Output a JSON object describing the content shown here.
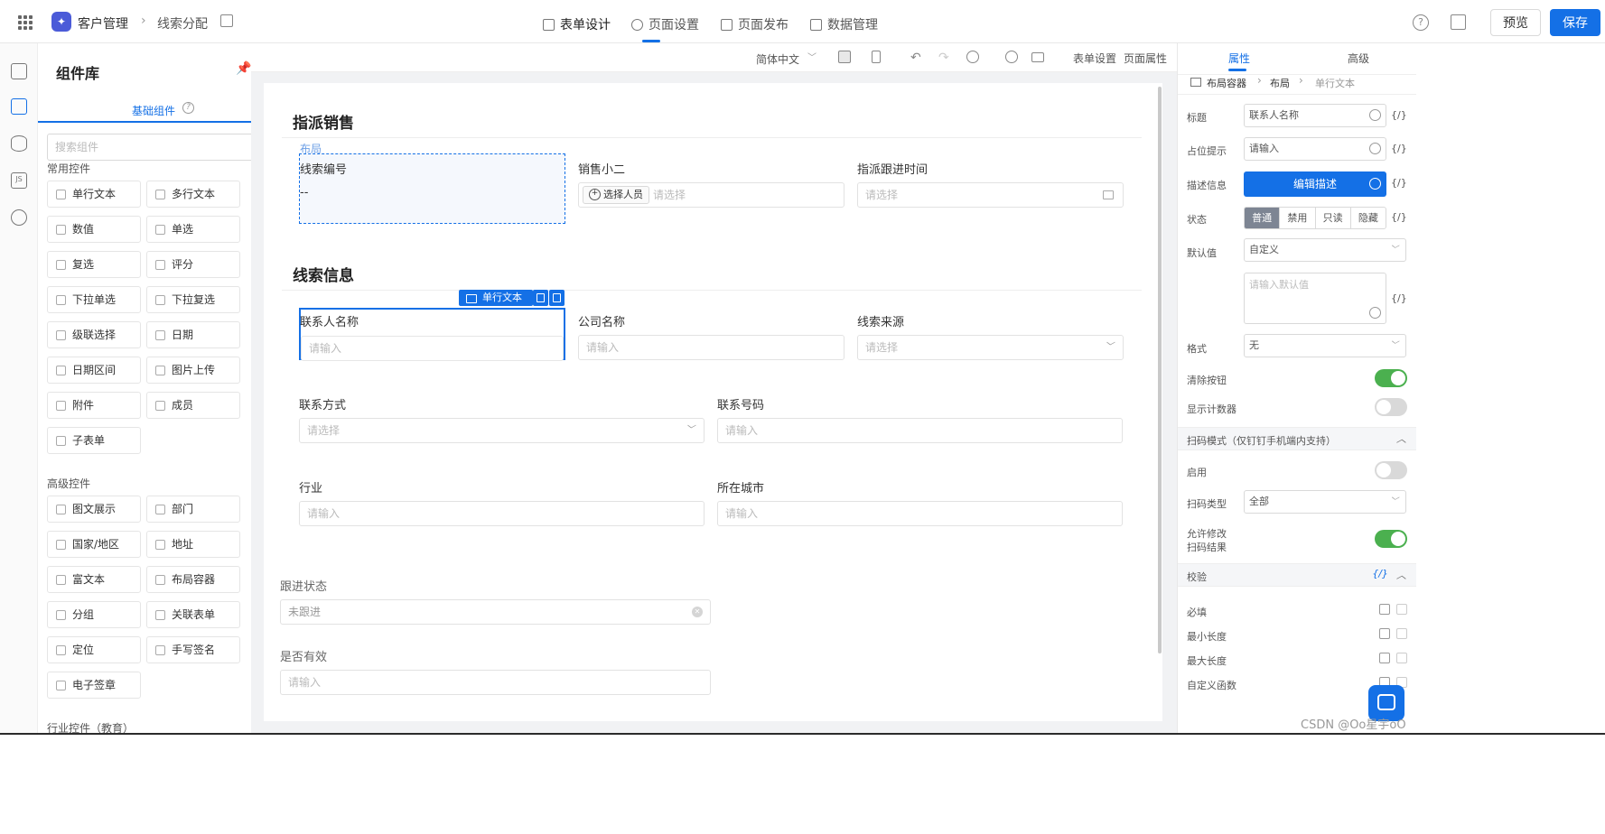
{
  "topbar": {
    "app_name": "客户管理",
    "page_name": "线索分配",
    "tabs": [
      "表单设计",
      "页面设置",
      "页面发布",
      "数据管理"
    ],
    "preview": "预览",
    "save": "保存",
    "help": "?"
  },
  "components": {
    "title": "组件库",
    "tab": "基础组件",
    "search_placeholder": "搜索组件",
    "common_label": "常用控件",
    "common": [
      "单行文本",
      "多行文本",
      "数值",
      "单选",
      "复选",
      "评分",
      "下拉单选",
      "下拉复选",
      "级联选择",
      "日期",
      "日期区间",
      "图片上传",
      "附件",
      "成员",
      "子表单"
    ],
    "advanced_label": "高级控件",
    "advanced": [
      "图文展示",
      "部门",
      "国家/地区",
      "地址",
      "富文本",
      "布局容器",
      "分组",
      "关联表单",
      "定位",
      "手写签名",
      "电子签章"
    ],
    "industry_label": "行业控件（教育）"
  },
  "toolbar": {
    "lang": "简体中文",
    "form_settings": "表单设置",
    "page_props": "页面属性"
  },
  "canvas": {
    "group1_title": "指派销售",
    "layout_tag": "布局",
    "f_clue_no_label": "线索编号",
    "f_clue_no_value": "--",
    "f_sales_label": "销售小二",
    "f_sales_pick": "选择人员",
    "f_sales_ph": "请选择",
    "f_assign_time_label": "指派跟进时间",
    "f_assign_time_ph": "请选择",
    "group2_title": "线索信息",
    "sel_tag": "单行文本",
    "f_contact_label": "联系人名称",
    "f_contact_ph": "请输入",
    "f_company_label": "公司名称",
    "f_company_ph": "请输入",
    "f_source_label": "线索来源",
    "f_source_ph": "请选择",
    "f_method_label": "联系方式",
    "f_method_ph": "请选择",
    "f_phone_label": "联系号码",
    "f_phone_ph": "请输入",
    "f_industry_label": "行业",
    "f_industry_ph": "请输入",
    "f_city_label": "所在城市",
    "f_city_ph": "请输入",
    "f_status_label": "跟进状态",
    "f_status_value": "未跟进",
    "f_valid_label": "是否有效",
    "f_valid_ph": "请输入"
  },
  "props": {
    "tab_props": "属性",
    "tab_adv": "高级",
    "crumbs": [
      "布局容器",
      "布局",
      "单行文本"
    ],
    "title_label": "标题",
    "title_value": "联系人名称",
    "ph_label": "占位提示",
    "ph_value": "请输入",
    "desc_label": "描述信息",
    "desc_btn": "编辑描述",
    "state_label": "状态",
    "states": [
      "普通",
      "禁用",
      "只读",
      "隐藏"
    ],
    "default_label": "默认值",
    "default_value": "自定义",
    "default_ph": "请输入默认值",
    "format_label": "格式",
    "format_value": "无",
    "clear_label": "清除按钮",
    "counter_label": "显示计数器",
    "scan_section": "扫码模式（仅钉钉手机端内支持）",
    "enable_label": "启用",
    "scan_type_label": "扫码类型",
    "scan_type_value": "全部",
    "allow_edit_label_1": "允许修改",
    "allow_edit_label_2": "扫码结果",
    "validate_section": "校验",
    "rules": [
      "必填",
      "最小长度",
      "最大长度",
      "自定义函数"
    ],
    "var": "{/}"
  },
  "watermark": "CSDN @Oo星宇oO"
}
